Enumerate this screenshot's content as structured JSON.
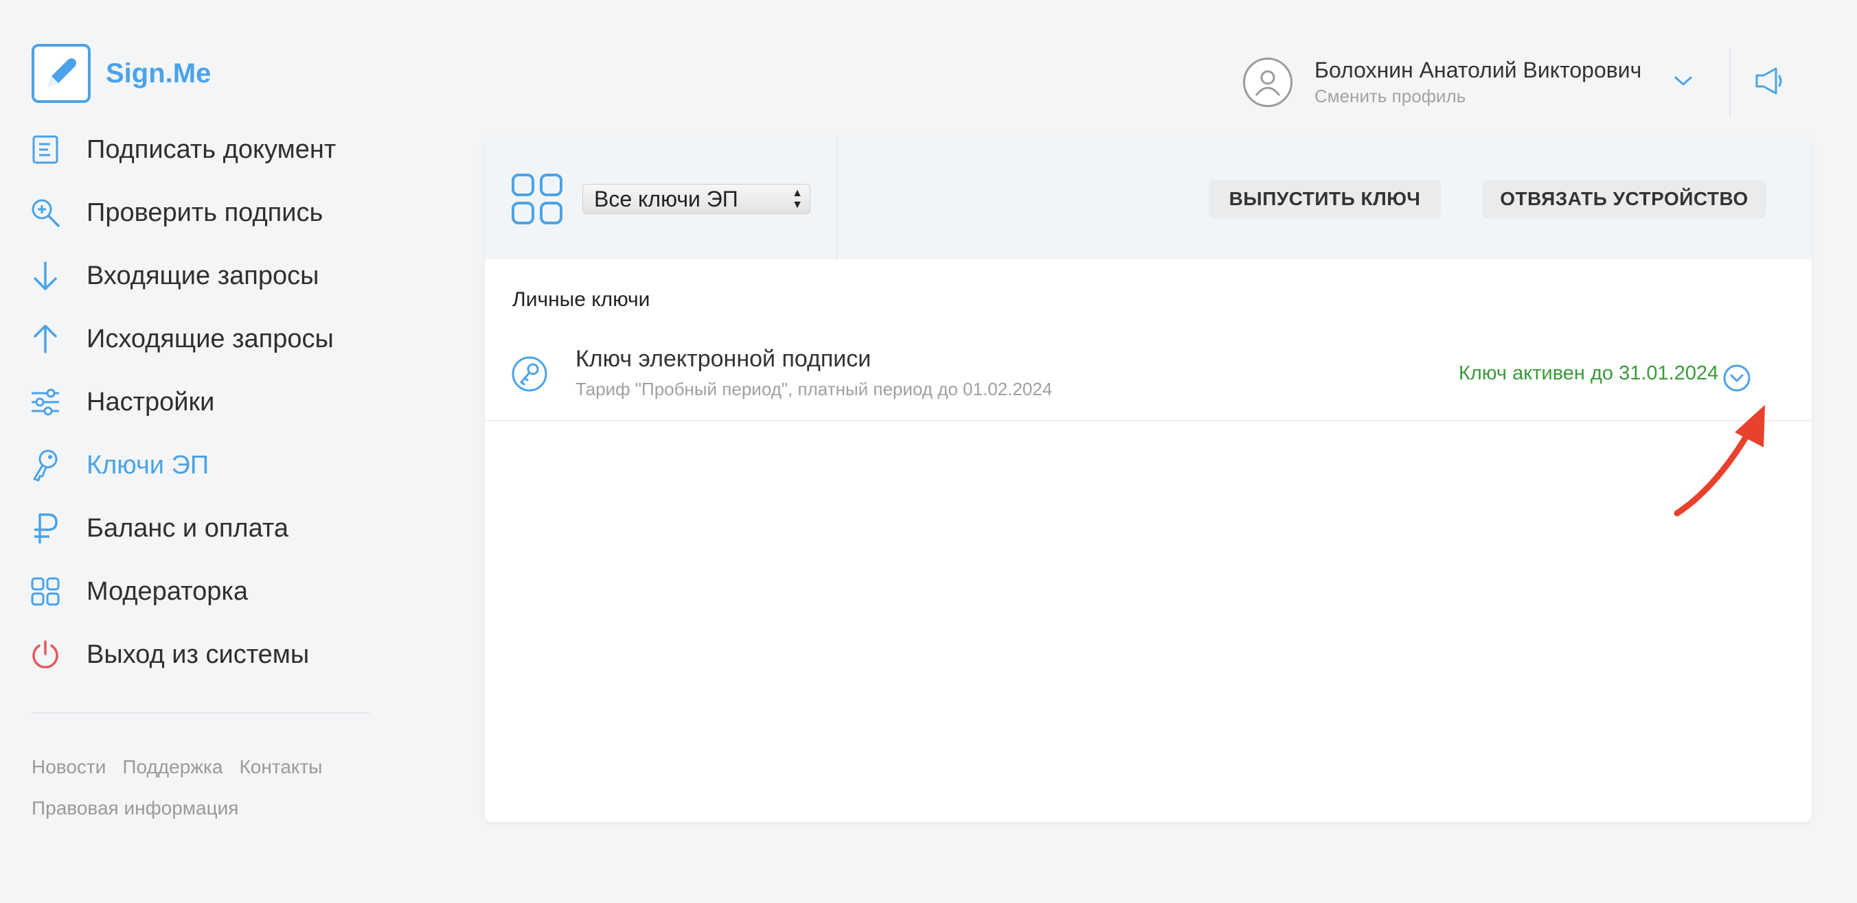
{
  "app": {
    "name": "Sign.Me"
  },
  "sidebar": {
    "items": [
      {
        "label": "Подписать документ",
        "icon": "document-icon"
      },
      {
        "label": "Проверить подпись",
        "icon": "magnifier-plus-icon"
      },
      {
        "label": "Входящие запросы",
        "icon": "arrow-down-icon"
      },
      {
        "label": "Исходящие запросы",
        "icon": "arrow-up-icon"
      },
      {
        "label": "Настройки",
        "icon": "sliders-icon"
      },
      {
        "label": "Ключи ЭП",
        "icon": "key-icon",
        "active": true
      },
      {
        "label": "Баланс и оплата",
        "icon": "ruble-icon"
      },
      {
        "label": "Модераторка",
        "icon": "grid-icon"
      },
      {
        "label": "Выход из системы",
        "icon": "power-icon"
      }
    ],
    "footer": {
      "news": "Новости",
      "support": "Поддержка",
      "contacts": "Контакты",
      "legal": "Правовая информация"
    }
  },
  "header": {
    "user_name": "Болохнин Анатолий Викторович",
    "switch_profile": "Сменить профиль"
  },
  "toolbar": {
    "filter_value": "Все ключи ЭП",
    "issue_key_label": "ВЫПУСТИТЬ КЛЮЧ",
    "unbind_device_label": "ОТВЯЗАТЬ УСТРОЙСТВО"
  },
  "keys": {
    "section_title": "Личные ключи",
    "items": [
      {
        "title": "Ключ электронной подписи",
        "subtitle": "Тариф \"Пробный период\", платный период до 01.02.2024",
        "status": "Ключ активен до 31.01.2024"
      }
    ]
  },
  "colors": {
    "accent": "#4aa3e8",
    "active_status": "#3b9a3a",
    "logout": "#e45a5a",
    "annotation_arrow": "#e8412c"
  }
}
